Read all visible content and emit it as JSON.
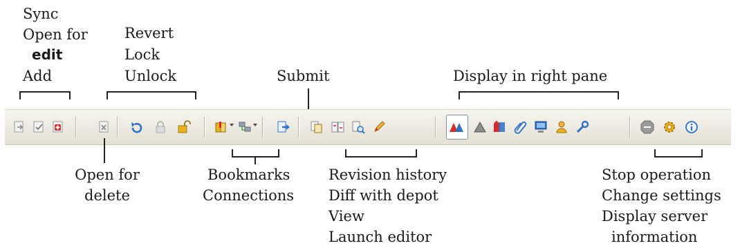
{
  "labels": {
    "sync": "Sync",
    "open_for": "Open for",
    "edit": "edit",
    "add": "Add",
    "revert": "Revert",
    "lock": "Lock",
    "unlock": "Unlock",
    "submit": "Submit",
    "display_right_pane": "Display in right pane",
    "open_for_delete_1": "Open for",
    "open_for_delete_2": "delete",
    "bookmarks": "Bookmarks",
    "connections": "Connections",
    "revision_history": "Revision history",
    "diff_with_depot": "Diff with depot",
    "view": "View",
    "launch_editor": "Launch editor",
    "stop_operation": "Stop operation",
    "change_settings": "Change settings",
    "display_server": "Display server",
    "information": "information"
  },
  "toolbar_icons": [
    "sync-icon",
    "open-for-edit-icon",
    "add-icon",
    "open-for-delete-icon",
    "revert-icon",
    "lock-icon",
    "unlock-icon",
    "bookmarks-icon",
    "connections-icon",
    "submit-icon",
    "revision-history-icon",
    "diff-with-depot-icon",
    "view-icon",
    "launch-editor-icon",
    "depot-view-icon",
    "workspace-view-icon",
    "pending-changelists-icon",
    "submitted-changelists-icon",
    "workspaces-icon",
    "users-icon",
    "jobs-icon",
    "stop-operation-icon",
    "change-settings-icon",
    "server-info-icon"
  ],
  "colors": {
    "toolbar_bg": "#ece9d8",
    "accent_red": "#d42a2a",
    "accent_blue": "#2f6fc4",
    "accent_yellow": "#e8b21e",
    "accent_green": "#4aa543"
  }
}
